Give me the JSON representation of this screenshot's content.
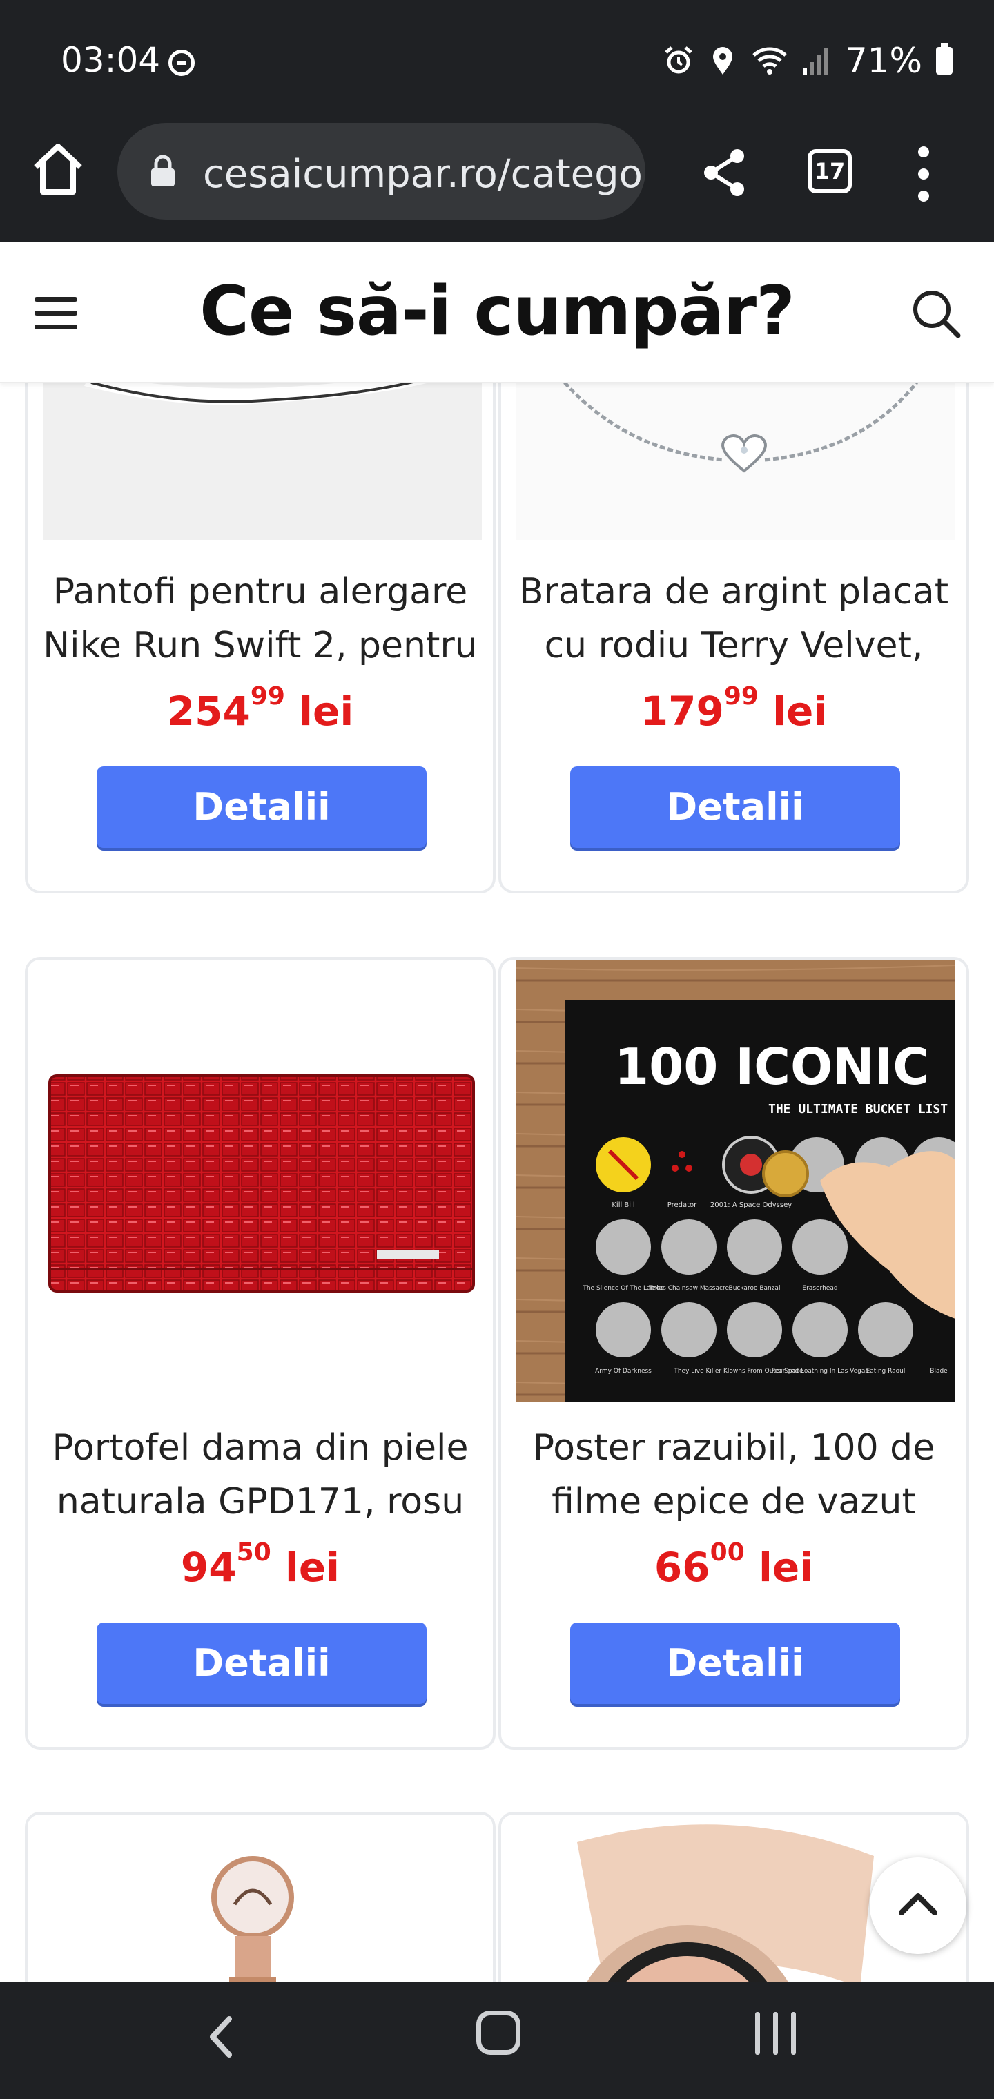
{
  "status_bar": {
    "time": "03:04",
    "battery": "71%",
    "icons": [
      "do-not-disturb-icon",
      "alarm-icon",
      "location-icon",
      "wifi-icon",
      "signal-icon",
      "battery-icon"
    ]
  },
  "browser": {
    "url": "cesaicumpar.ro/catego",
    "tab_count": "17",
    "icons": [
      "home-icon",
      "lock-icon",
      "share-icon",
      "tabs-icon",
      "more-menu-icon"
    ]
  },
  "site": {
    "title": "Ce să-i cumpăr?",
    "icons": [
      "hamburger-menu-icon",
      "search-icon"
    ]
  },
  "products": [
    {
      "title": "Pantofi pentru alergare Nike Run Swift 2, pentru",
      "price_main": "254",
      "price_cents": "99",
      "currency": "lei",
      "button": "Detalii",
      "image": "white-sneaker-image"
    },
    {
      "title": "Bratara de argint placat cu rodiu Terry Velvet,",
      "price_main": "179",
      "price_cents": "99",
      "currency": "lei",
      "button": "Detalii",
      "image": "silver-bracelet-image"
    },
    {
      "title": "Portofel dama din piele naturala GPD171, rosu",
      "price_main": "94",
      "price_cents": "50",
      "currency": "lei",
      "button": "Detalii",
      "image": "red-wallet-image"
    },
    {
      "title": "Poster razuibil, 100 de filme epice de vazut",
      "price_main": "66",
      "price_cents": "00",
      "currency": "lei",
      "button": "Detalii",
      "image": "scratch-poster-image",
      "poster": {
        "headline": "100 ICONIC",
        "subhead": "THE ULTIMATE BUCKET LIST",
        "row1": [
          "Kill Bill",
          "Predator",
          "2001: A Space Odyssey"
        ],
        "row2": [
          "The Silence Of The Lambs",
          "Texas Chainsaw Massacre",
          "Buckaroo Banzai",
          "Eraserhead"
        ],
        "row3": [
          "Army Of Darkness",
          "They Live",
          "Killer Klowns From Outer Space",
          "Fear and Loathing In Las Vegas",
          "Eating Raoul",
          "Blade"
        ]
      }
    },
    {
      "image": "perfume-bottle-image"
    },
    {
      "image": "smartwatch-image"
    }
  ],
  "nav": {
    "icons": [
      "back-icon",
      "home-nav-icon",
      "recent-apps-icon",
      "scroll-top-icon"
    ]
  }
}
